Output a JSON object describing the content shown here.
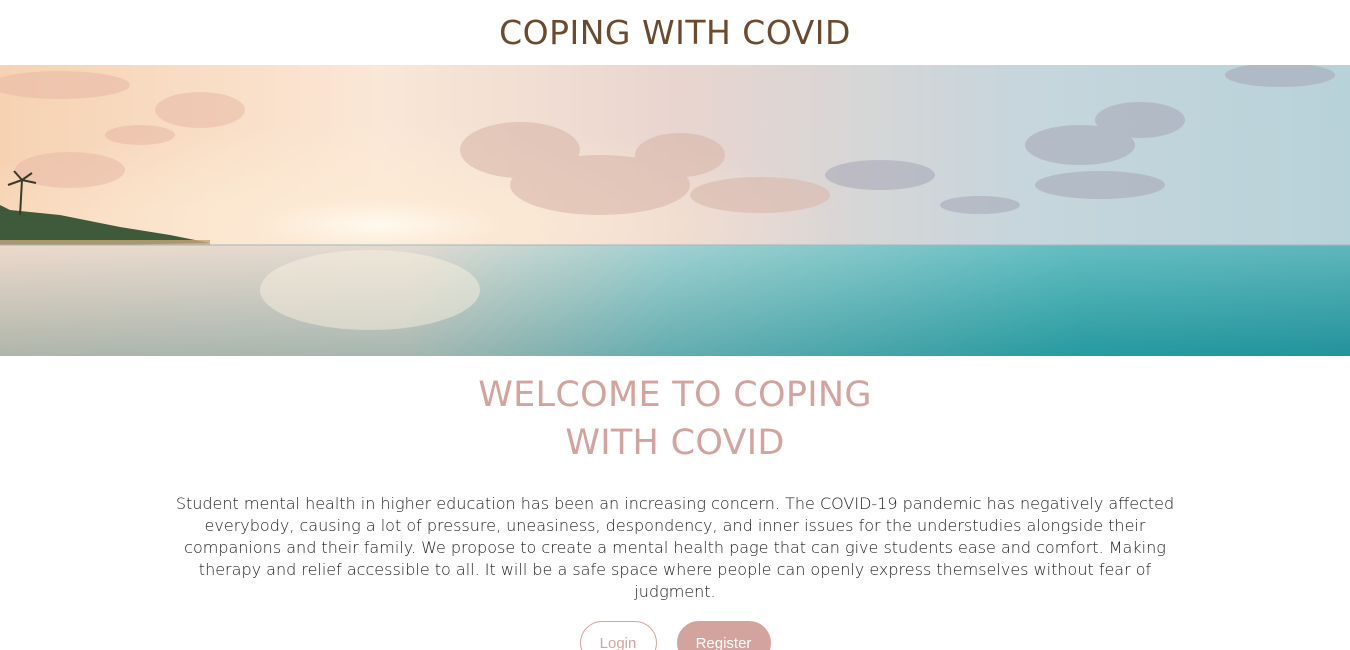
{
  "header": {
    "title": "COPING WITH COVID"
  },
  "hero": {
    "image": "beach-sunset-image"
  },
  "welcome": {
    "title_line1": "WELCOME TO COPING",
    "title_line2": "WITH COVID",
    "intro": "Student mental health in higher education has been an increasing concern. The COVID-19 pandemic has negatively affected everybody, causing a lot of pressure, uneasiness, despondency, and inner issues for the understudies alongside their companions and their family. We propose to create a mental health page that can give students ease and comfort. Making therapy and relief accessible to all. It will be a safe space where people can openly express themselves without fear of judgment."
  },
  "actions": {
    "login_label": "Login",
    "register_label": "Register"
  },
  "colors": {
    "title": "#6b4a2e",
    "accent": "#d3a39e"
  }
}
